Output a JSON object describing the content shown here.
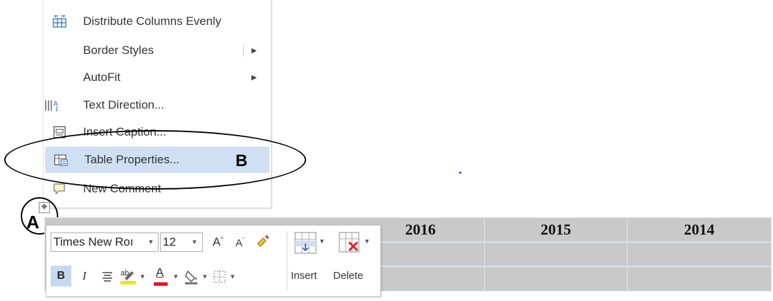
{
  "context_menu": {
    "items": [
      {
        "label": "Distribute Columns Evenly",
        "icon": "distribute-columns-icon"
      },
      {
        "label": "Border Styles",
        "icon": "",
        "has_submenu": true
      },
      {
        "label": "AutoFit",
        "icon": "",
        "has_submenu": true
      },
      {
        "label": "Text Direction...",
        "icon": "text-direction-icon"
      },
      {
        "label": "Insert Caption...",
        "icon": "insert-caption-icon"
      },
      {
        "label": "Table Properties...",
        "icon": "table-properties-icon",
        "highlighted": true
      },
      {
        "label": "New Comment",
        "icon": "new-comment-icon"
      }
    ]
  },
  "annotations": {
    "a": "A",
    "b": "B"
  },
  "table": {
    "headers": [
      "2016",
      "2015",
      "2014"
    ],
    "header_bg": "#c9c9c9"
  },
  "mini_toolbar": {
    "font_name": "Times New Roı",
    "font_size": "12",
    "insert_label": "Insert",
    "delete_label": "Delete",
    "bold": "B",
    "italic": "I",
    "grow_font": "A",
    "shrink_font": "A",
    "font_color": "A",
    "highlight_color": "#f5e200",
    "font_color_bar": "#e81123"
  },
  "colors": {
    "highlight": "#cfe0f3",
    "bold_active": "#c5daf0"
  }
}
